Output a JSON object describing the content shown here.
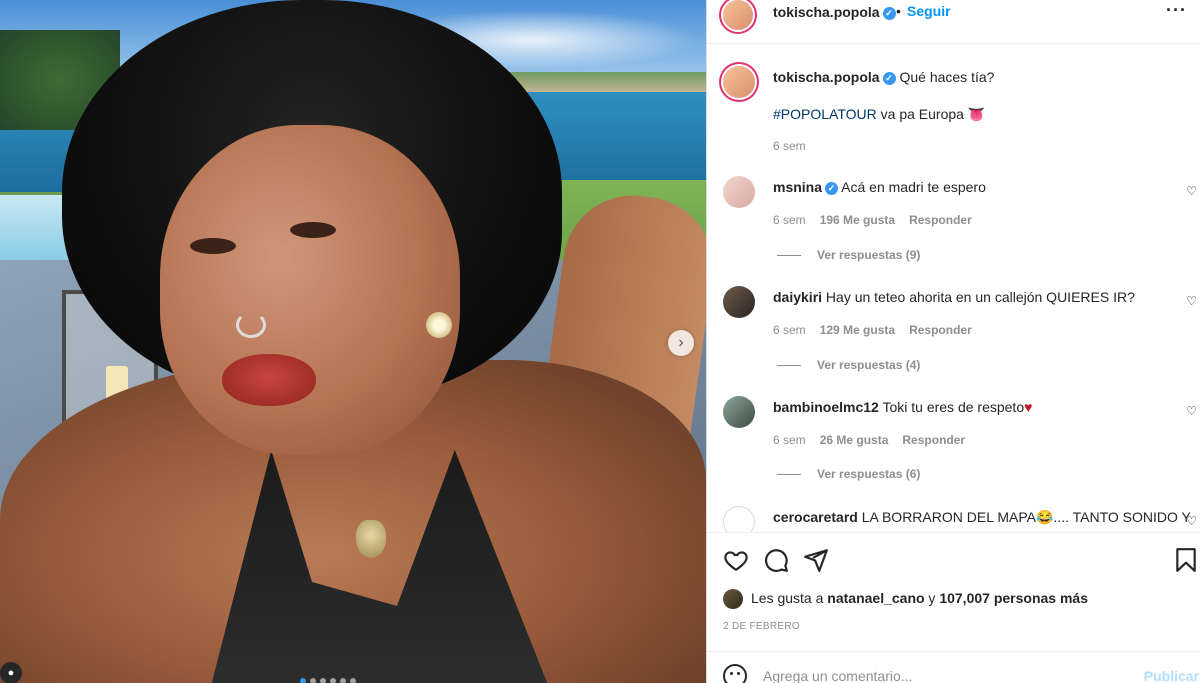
{
  "post": {
    "author": "tokischa.popola",
    "follow_label": "Seguir",
    "separator": "•",
    "more_label": "···"
  },
  "caption": {
    "user": "tokischa.popola",
    "text": "Qué haces tía?",
    "hashtag": "#POPOLATOUR",
    "line2": " va pa Europa 👅",
    "time": "6 sem"
  },
  "comments": [
    {
      "user": "msnina",
      "verified": true,
      "text": "Acá en madri te espero",
      "time": "6 sem",
      "likes": "196 Me gusta",
      "reply": "Responder",
      "replies": "Ver respuestas (9)"
    },
    {
      "user": "daiykiri",
      "verified": false,
      "text": "Hay un teteo ahorita en un callejón QUIERES IR?",
      "time": "6 sem",
      "likes": "129 Me gusta",
      "reply": "Responder",
      "replies": "Ver respuestas (4)"
    },
    {
      "user": "bambinoelmc12",
      "verified": false,
      "text": "Toki tu eres de respeto",
      "heart": "♥",
      "time": "6 sem",
      "likes": "26 Me gusta",
      "reply": "Responder",
      "replies": "Ver respuestas (6)"
    },
    {
      "user": "cerocaretard",
      "verified": false,
      "text": "LA BORRARON DEL MAPA😂.... TANTO SONIDO Y"
    }
  ],
  "likes": {
    "prefix": "Les gusta a ",
    "user": "natanael_cano",
    "joiner": " y ",
    "rest": "107,007 personas más"
  },
  "date": "2 DE FEBRERO",
  "composer": {
    "placeholder": "Agrega un comentario...",
    "publish_label": "Publicar"
  },
  "icons": [
    "heart-icon",
    "comment-icon",
    "share-icon",
    "bookmark-icon",
    "emoji-icon",
    "chevron-right-icon",
    "user-tag-icon",
    "more-icon",
    "verified-icon"
  ],
  "colors": {
    "link": "#0095f6",
    "hashtag": "#00376b",
    "muted": "#8e8e8e",
    "publish_disabled": "#b2dffc",
    "verified": "#3897f0",
    "story_ring": "#e1306c"
  },
  "carousel": {
    "slide_count": 6,
    "active_slide": 1
  }
}
